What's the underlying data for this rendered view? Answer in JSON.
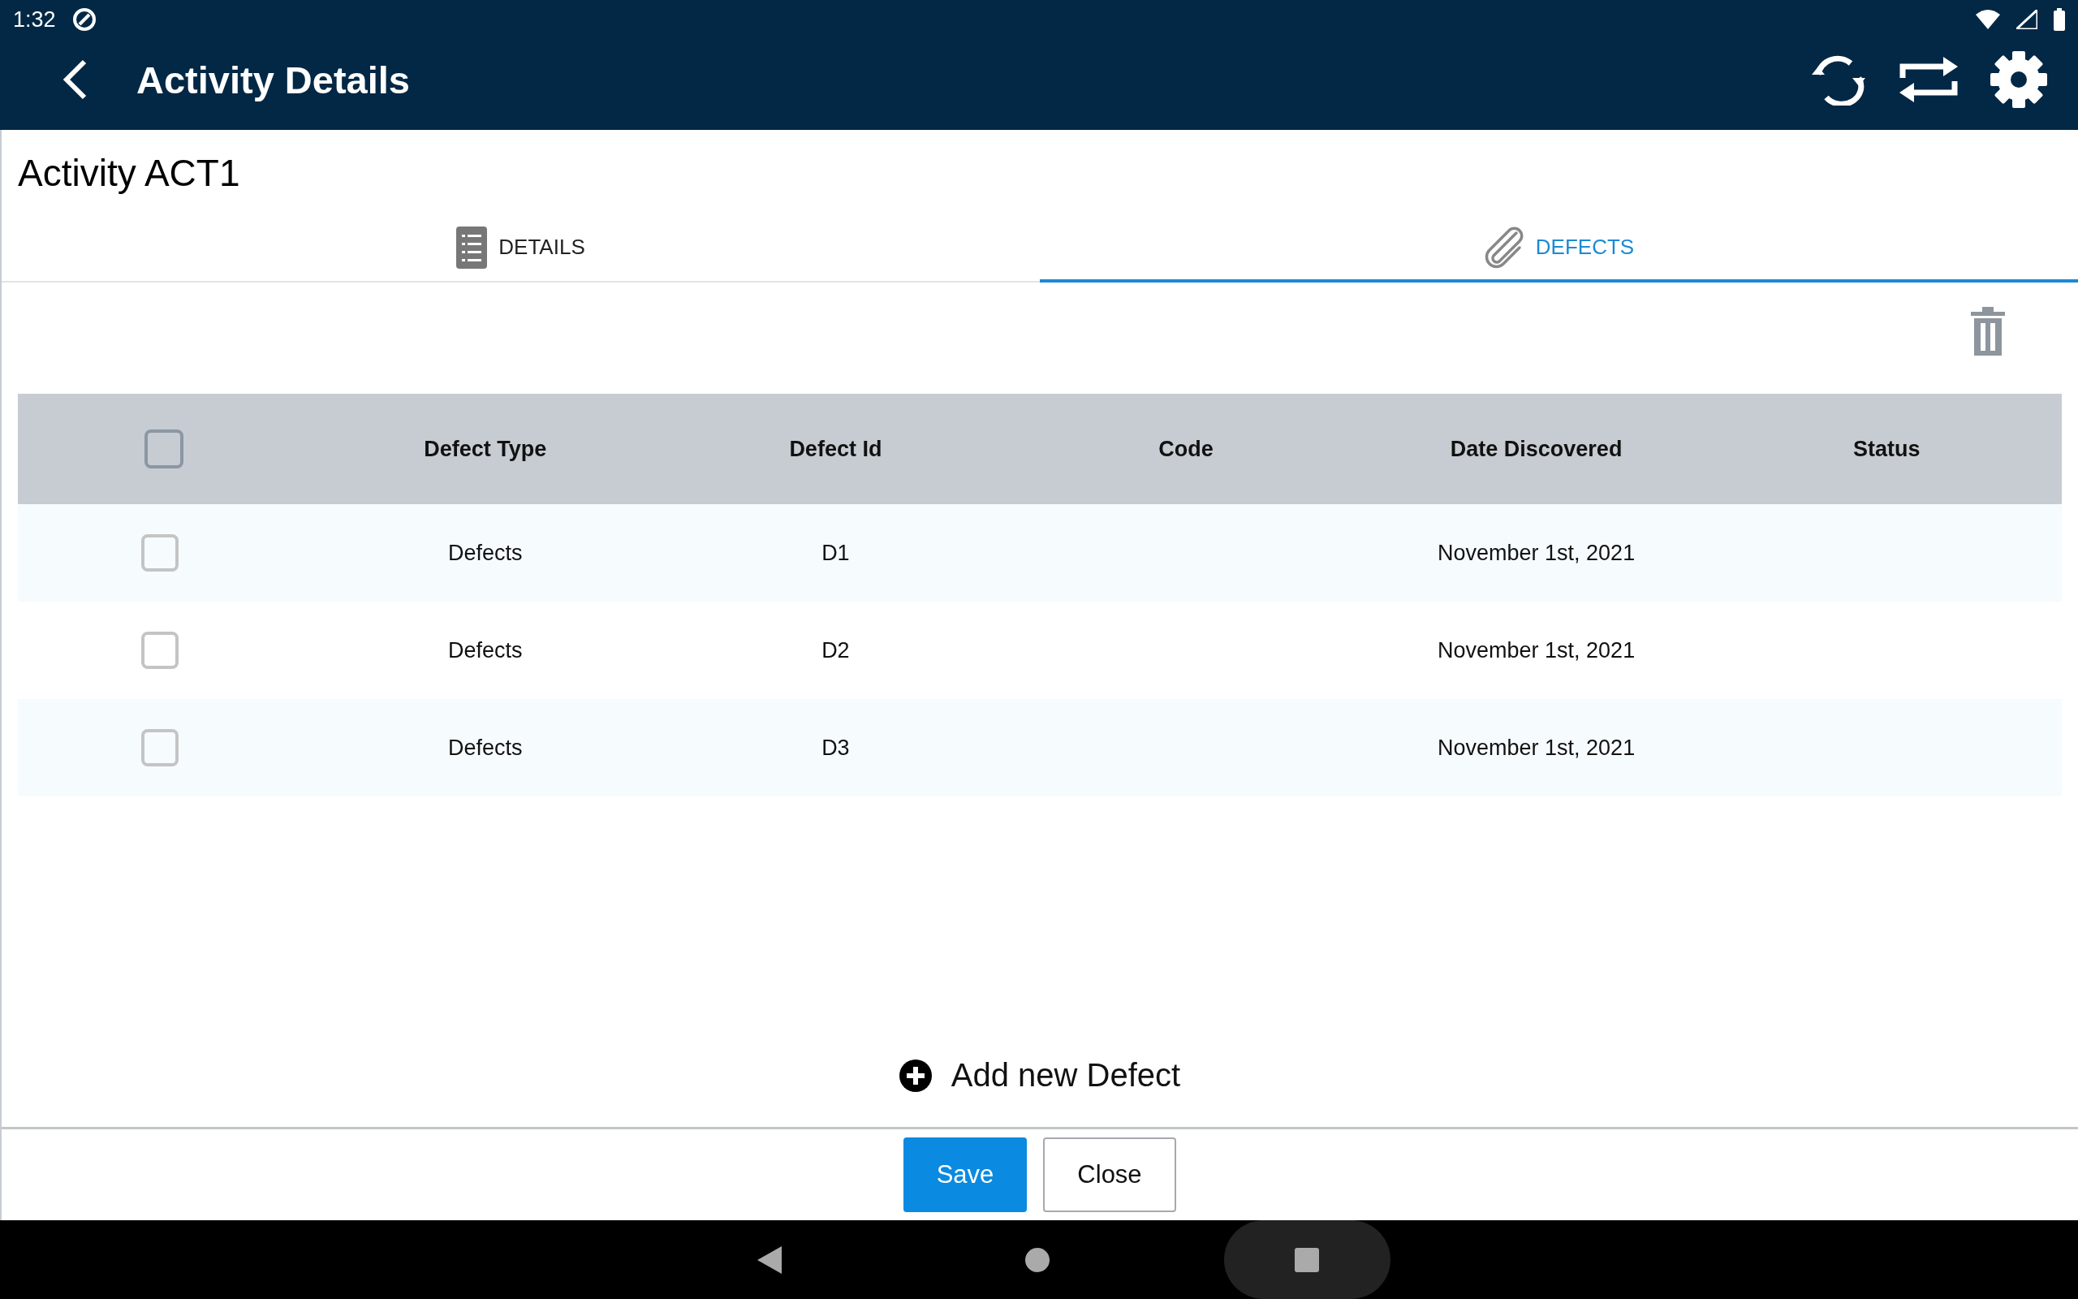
{
  "status_bar": {
    "time": "1:32"
  },
  "app_bar": {
    "title": "Activity Details"
  },
  "heading": "Activity ACT1",
  "tabs": [
    {
      "label": "DETAILS",
      "kind": "list",
      "selected": false
    },
    {
      "label": "DEFECTS",
      "kind": "clip",
      "selected": true
    }
  ],
  "table": {
    "select_all": {
      "checked": false
    },
    "columns": [
      "Defect Type",
      "Defect Id",
      "Code",
      "Date Discovered",
      "Status"
    ],
    "rows": [
      {
        "checked": false,
        "cells": [
          "Defects",
          "D1",
          "",
          "November 1st, 2021",
          ""
        ]
      },
      {
        "checked": false,
        "cells": [
          "Defects",
          "D2",
          "",
          "November 1st, 2021",
          ""
        ]
      },
      {
        "checked": false,
        "cells": [
          "Defects",
          "D3",
          "",
          "November 1st, 2021",
          ""
        ]
      }
    ]
  },
  "add_action": "Add new Defect",
  "buttons": [
    {
      "label": "Save",
      "kind": "primary"
    },
    {
      "label": "Close",
      "kind": "secondary"
    }
  ]
}
